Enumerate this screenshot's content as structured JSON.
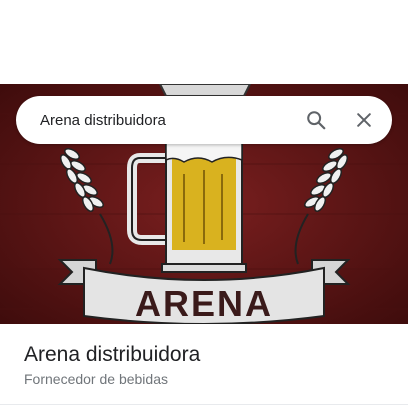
{
  "search": {
    "query": "Arena distribuidora",
    "search_icon": "search-icon",
    "clear_icon": "close-icon"
  },
  "hero": {
    "sign_text": "ARENA"
  },
  "place": {
    "name": "Arena distribuidora",
    "category": "Fornecedor de bebidas"
  },
  "colors": {
    "hero_background": "#5a1414",
    "beer": "#d9b21f",
    "banner": "#e4e4e4",
    "name_text": "#202124",
    "category_text": "#70757a",
    "icon": "#5f6368"
  }
}
